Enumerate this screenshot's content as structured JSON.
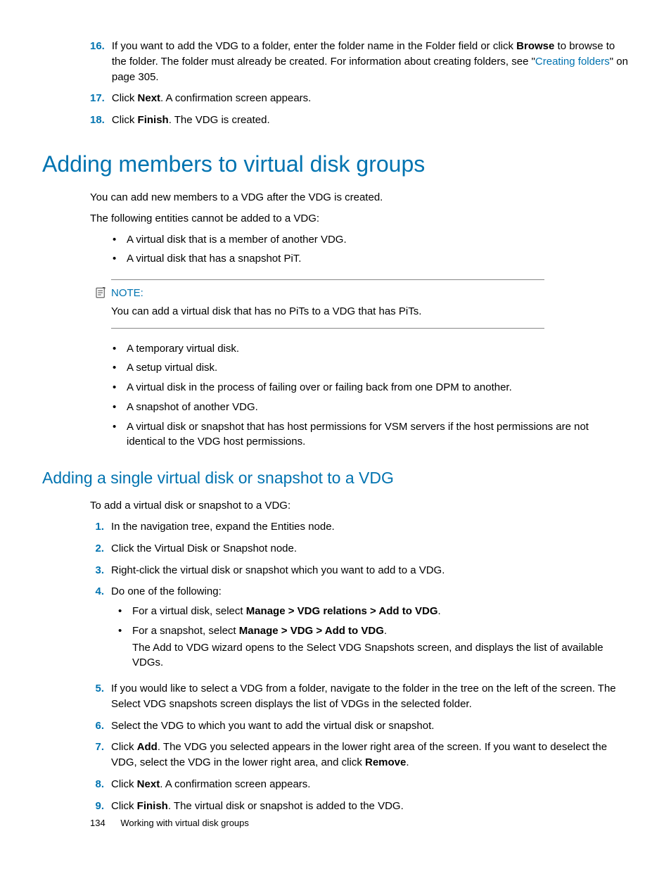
{
  "top_steps": [
    {
      "num": "16.",
      "parts": [
        {
          "t": "If you want to add the VDG to a folder, enter the folder name in the Folder field or click "
        },
        {
          "t": "Browse",
          "bold": true
        },
        {
          "t": " to browse to the folder. The folder must already be created. For information about creating folders, see \""
        },
        {
          "t": "Creating folders",
          "link": true
        },
        {
          "t": "\" on page 305."
        }
      ]
    },
    {
      "num": "17.",
      "parts": [
        {
          "t": "Click "
        },
        {
          "t": "Next",
          "bold": true
        },
        {
          "t": ". A confirmation screen appears."
        }
      ]
    },
    {
      "num": "18.",
      "parts": [
        {
          "t": "Click "
        },
        {
          "t": "Finish",
          "bold": true
        },
        {
          "t": ". The VDG is created."
        }
      ]
    }
  ],
  "h1": "Adding members to virtual disk groups",
  "p1": "You can add new members to a VDG after the VDG is created.",
  "p2": "The following entities cannot be added to a VDG:",
  "bullets1": [
    "A virtual disk that is a member of another VDG.",
    "A virtual disk that has a snapshot PiT."
  ],
  "note_label": "NOTE:",
  "note_body": "You can add a virtual disk that has no PiTs to a VDG that has PiTs.",
  "bullets2": [
    "A temporary virtual disk.",
    "A setup virtual disk.",
    "A virtual disk in the process of failing over or failing back from one DPM to another.",
    "A snapshot of another VDG.",
    "A virtual disk or snapshot that has host permissions for VSM servers if the host permissions are not identical to the VDG host permissions."
  ],
  "h2": "Adding a single virtual disk or snapshot to a VDG",
  "p3": "To add a virtual disk or snapshot to a VDG:",
  "steps2": [
    {
      "num": "1.",
      "parts": [
        {
          "t": "In the navigation tree, expand the Entities node."
        }
      ]
    },
    {
      "num": "2.",
      "parts": [
        {
          "t": "Click the Virtual Disk or Snapshot node."
        }
      ]
    },
    {
      "num": "3.",
      "parts": [
        {
          "t": "Right-click the virtual disk or snapshot which you want to add to a VDG."
        }
      ]
    },
    {
      "num": "4.",
      "parts": [
        {
          "t": "Do one of the following:"
        }
      ],
      "sub": [
        {
          "parts": [
            {
              "t": "For a virtual disk, select "
            },
            {
              "t": "Manage > VDG relations > Add to VDG",
              "bold": true
            },
            {
              "t": "."
            }
          ]
        },
        {
          "parts": [
            {
              "t": "For a snapshot, select "
            },
            {
              "t": "Manage > VDG > Add to VDG",
              "bold": true
            },
            {
              "t": "."
            }
          ],
          "after": "The Add to VDG wizard opens to the Select VDG Snapshots screen, and displays the list of available VDGs."
        }
      ]
    },
    {
      "num": "5.",
      "parts": [
        {
          "t": "If you would like to select a VDG from a folder, navigate to the folder in the tree on the left of the screen. The Select VDG snapshots screen displays the list of VDGs in the selected folder."
        }
      ]
    },
    {
      "num": "6.",
      "parts": [
        {
          "t": "Select the VDG to which you want to add the virtual disk or snapshot."
        }
      ]
    },
    {
      "num": "7.",
      "parts": [
        {
          "t": "Click "
        },
        {
          "t": "Add",
          "bold": true
        },
        {
          "t": ". The VDG you selected appears in the lower right area of the screen. If you want to deselect the VDG, select the VDG in the lower right area, and click "
        },
        {
          "t": "Remove",
          "bold": true
        },
        {
          "t": "."
        }
      ]
    },
    {
      "num": "8.",
      "parts": [
        {
          "t": "Click "
        },
        {
          "t": "Next",
          "bold": true
        },
        {
          "t": ". A confirmation screen appears."
        }
      ]
    },
    {
      "num": "9.",
      "parts": [
        {
          "t": "Click "
        },
        {
          "t": "Finish",
          "bold": true
        },
        {
          "t": ". The virtual disk or snapshot is added to the VDG."
        }
      ]
    }
  ],
  "footer_page": "134",
  "footer_text": "Working with virtual disk groups"
}
